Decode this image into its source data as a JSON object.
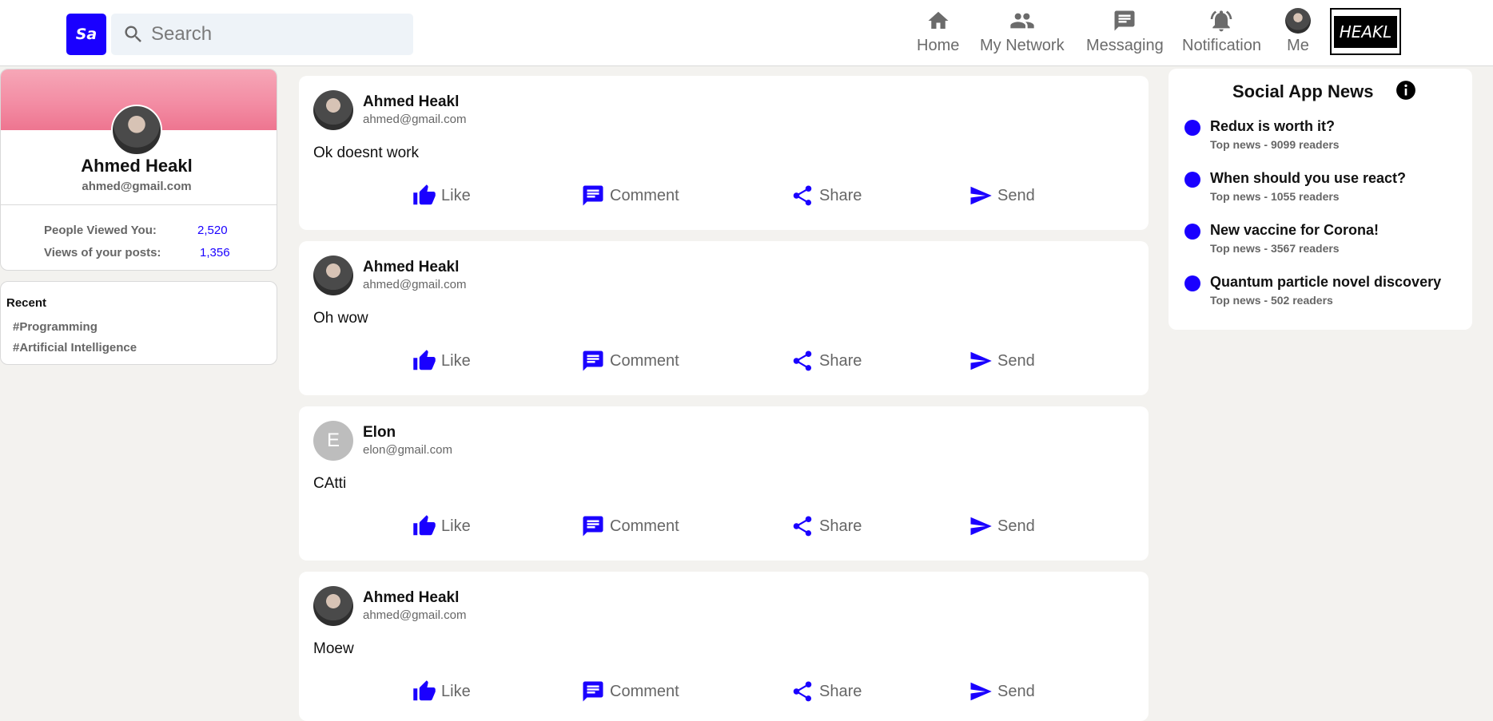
{
  "header": {
    "logo_text": "Sa",
    "search_placeholder": "Search",
    "nav": [
      {
        "label": "Home",
        "icon": "home-icon"
      },
      {
        "label": "My Network",
        "icon": "network-icon"
      },
      {
        "label": "Messaging",
        "icon": "messaging-icon"
      },
      {
        "label": "Notification",
        "icon": "notification-icon"
      },
      {
        "label": "Me",
        "icon": "avatar"
      }
    ],
    "brand": "HEAKL"
  },
  "profile": {
    "name": "Ahmed Heakl",
    "email": "ahmed@gmail.com",
    "stats": [
      {
        "label": "People Viewed You:",
        "value": "2,520"
      },
      {
        "label": "Views of your posts:",
        "value": "1,356"
      }
    ]
  },
  "recent": {
    "title": "Recent",
    "tags": [
      "#Programming",
      "#Artificial Intelligence"
    ]
  },
  "posts": [
    {
      "author": "Ahmed Heakl",
      "email": "ahmed@gmail.com",
      "text": "Ok doesnt work",
      "avatar_letter": ""
    },
    {
      "author": "Ahmed Heakl",
      "email": "ahmed@gmail.com",
      "text": "Oh wow",
      "avatar_letter": ""
    },
    {
      "author": "Elon",
      "email": "elon@gmail.com",
      "text": "CAtti",
      "avatar_letter": "E"
    },
    {
      "author": "Ahmed Heakl",
      "email": "ahmed@gmail.com",
      "text": "Moew",
      "avatar_letter": ""
    }
  ],
  "post_actions": {
    "like": "Like",
    "comment": "Comment",
    "share": "Share",
    "send": "Send"
  },
  "news": {
    "title": "Social App News",
    "items": [
      {
        "headline": "Redux is worth it?",
        "sub": "Top news - 9099 readers"
      },
      {
        "headline": "When should you use react?",
        "sub": "Top news - 1055 readers"
      },
      {
        "headline": "New vaccine for Corona!",
        "sub": "Top news - 3567 readers"
      },
      {
        "headline": "Quantum particle novel discovery",
        "sub": "Top news - 502 readers"
      }
    ]
  },
  "colors": {
    "accent": "#1a00ff",
    "background": "#f3f2ef",
    "muted": "#666666"
  }
}
